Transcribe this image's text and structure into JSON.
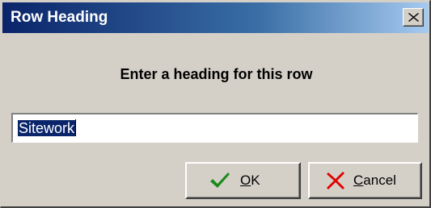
{
  "window": {
    "title": "Row Heading",
    "close_icon": "close-x-icon"
  },
  "dialog": {
    "prompt": "Enter a heading for this row",
    "input_value": "Sitework",
    "input_selected": true
  },
  "buttons": {
    "ok": {
      "mnemonic": "O",
      "rest": "K",
      "icon": "check-icon",
      "icon_color": "#1a8a1a"
    },
    "cancel": {
      "mnemonic": "C",
      "rest": "ancel",
      "icon": "x-cancel-icon",
      "icon_color": "#e00000"
    }
  },
  "colors": {
    "titlebar_start": "#0a246a",
    "titlebar_end": "#a6caf0",
    "dialog_bg": "#d4d0c8",
    "selection_bg": "#0a246a"
  }
}
